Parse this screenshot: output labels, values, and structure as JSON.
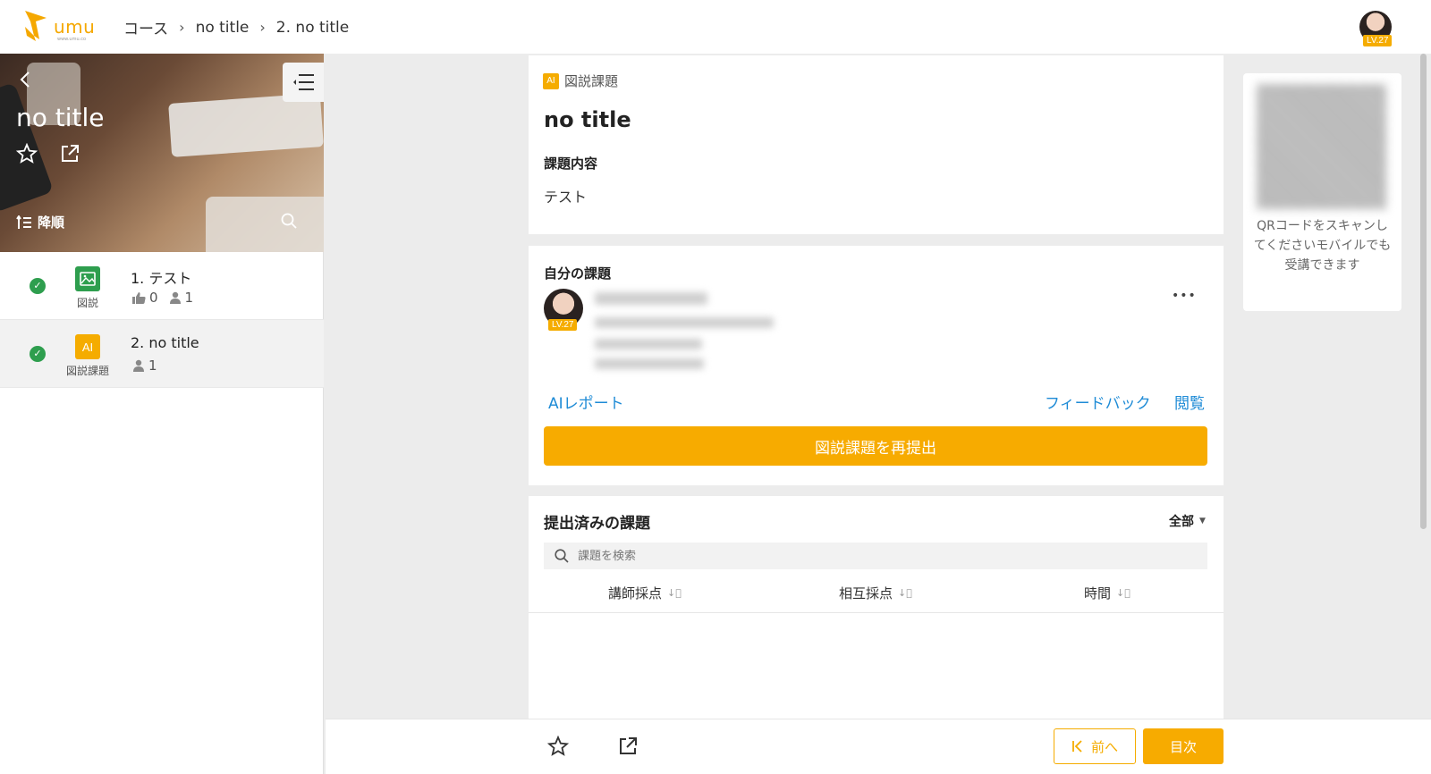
{
  "app": {
    "logo_text": "umu",
    "logo_sub": "www.umu.co"
  },
  "breadcrumb": [
    "コース",
    "no title",
    "2. no title"
  ],
  "user": {
    "level": "LV.27"
  },
  "sidebar": {
    "course_title": "no title",
    "order_label": "降順",
    "lessons": [
      {
        "title": "1. テスト",
        "type": "図説",
        "likes": "0",
        "learners": "1",
        "type_color": "#2e9e4e"
      },
      {
        "title": "2. no title",
        "type": "図説課題",
        "type_icon": "AI",
        "learners": "1",
        "type_color": "#f5ac00"
      }
    ]
  },
  "task": {
    "badge_icon": "AI",
    "badge": "図説課題",
    "title": "no title",
    "content_heading": "課題内容",
    "content": "テスト"
  },
  "my_task": {
    "heading": "自分の課題",
    "user_level": "LV.27",
    "more": "•••",
    "ai_report": "AIレポート",
    "feedback": "フィードバック",
    "view": "閲覧",
    "resubmit": "図説課題を再提出"
  },
  "submitted": {
    "heading": "提出済みの課題",
    "filter": "全部",
    "search_placeholder": "課題を検索",
    "columns": [
      "講師採点",
      "相互採点",
      "時間"
    ]
  },
  "qr": {
    "text": "QRコードをスキャンしてくださいモバイルでも受講できます"
  },
  "footer": {
    "prev": "前へ",
    "toc": "目次"
  },
  "colors": {
    "accent": "#f7ab00",
    "link": "#1e8bd6",
    "check": "#2e9e4e"
  }
}
